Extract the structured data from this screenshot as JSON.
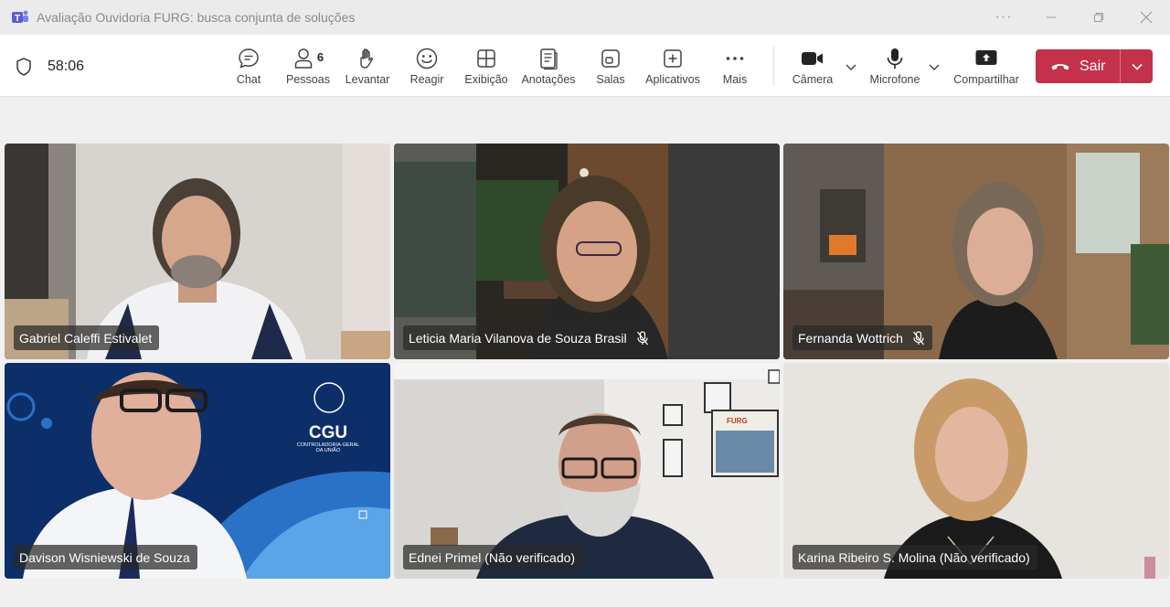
{
  "window": {
    "title": "Avaliação Ouvidoria FURG: busca conjunta de soluções",
    "more_glyph": "···"
  },
  "meeting": {
    "timer": "58:06"
  },
  "toolbar": {
    "chat": "Chat",
    "people": "Pessoas",
    "people_count": "6",
    "raise": "Levantar",
    "react": "Reagir",
    "view": "Exibição",
    "notes": "Anotações",
    "rooms": "Salas",
    "apps": "Aplicativos",
    "more": "Mais",
    "camera": "Câmera",
    "mic": "Microfone",
    "share": "Compartilhar",
    "leave": "Sair"
  },
  "participants": [
    {
      "name": "Gabriel Caleffi Estivalet",
      "muted": false
    },
    {
      "name": "Leticia Maria Vilanova de Souza Brasil",
      "muted": true
    },
    {
      "name": "Fernanda Wottrich",
      "muted": true
    },
    {
      "name": "Davison Wisniewski de Souza",
      "muted": false
    },
    {
      "name": "Ednei Primel (Não verificado)",
      "muted": false
    },
    {
      "name": "Karina Ribeiro S. Molina (Não verificado)",
      "muted": false
    }
  ],
  "background_text": {
    "cgu_logo": "CGU",
    "cgu_subtitle_1": "CONTROLADORIA-GERAL",
    "cgu_subtitle_2": "DA UNIÃO",
    "poster": "FURG"
  },
  "colors": {
    "leave": "#c4314b",
    "brand": "#5b5fc7"
  },
  "icons": [
    "teams-logo-icon",
    "shield-icon",
    "chat-icon",
    "people-icon",
    "raise-hand-icon",
    "react-icon",
    "view-icon",
    "notes-icon",
    "rooms-icon",
    "apps-icon",
    "more-icon",
    "camera-icon",
    "microphone-icon",
    "share-icon",
    "phone-hangup-icon",
    "mic-off-icon"
  ]
}
